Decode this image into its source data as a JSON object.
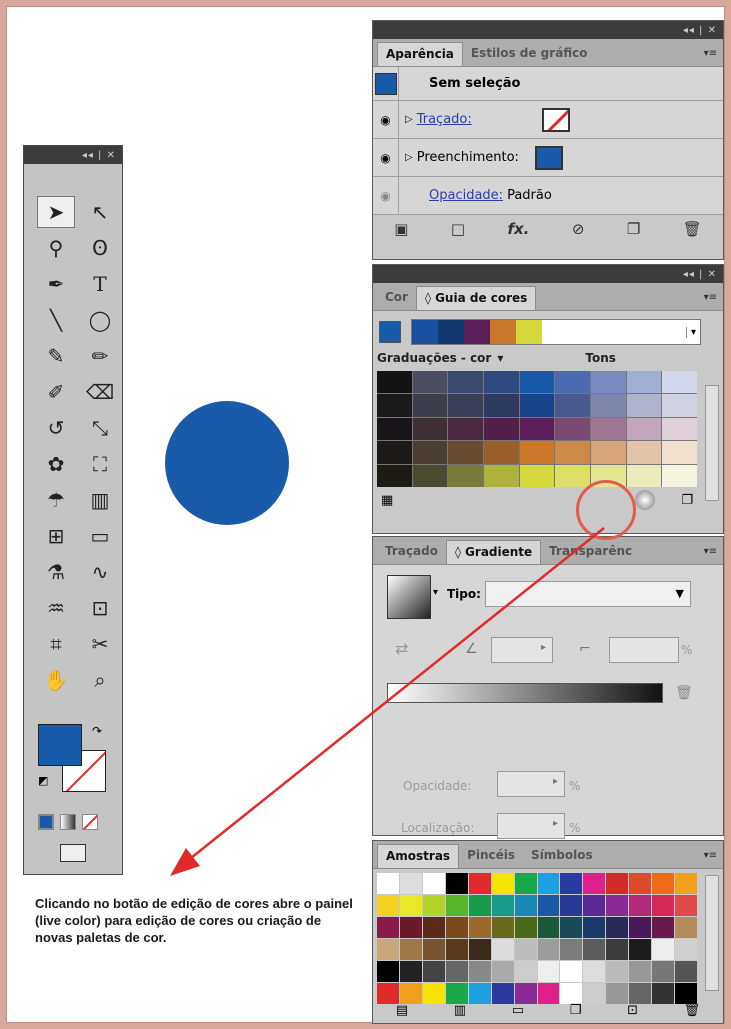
{
  "appearance_panel": {
    "tabs": [
      "Aparência",
      "Estilos de gráfico"
    ],
    "no_selection": "Sem seleção",
    "stroke_label": "Traçado:",
    "fill_label": "Preenchimento:",
    "opacity_label": "Opacidade:",
    "opacity_value": "Padrão",
    "menu_icon": "panel-menu-icon",
    "bottom_icons": [
      "new-stroke-icon",
      "new-fill-icon",
      "fx-icon",
      "clear-icon",
      "duplicate-icon",
      "delete-icon"
    ]
  },
  "color_guide_panel": {
    "tabs": [
      "Cor",
      "◊ Guia de cores"
    ],
    "variations_label": "Graduações - cor",
    "tones_label": "Tons",
    "harmony_colors": [
      "#1a4fa0",
      "#123a70",
      "#5c1f5a",
      "#c87828",
      "#d4d83c"
    ],
    "colors": {
      "blue": "#1a5aaa",
      "red": "#e12a2a"
    }
  },
  "gradient_panel": {
    "tabs": [
      "Traçado",
      "◊ Gradiente",
      "Transparênc"
    ],
    "type_label": "Tipo:",
    "opacity_label": "Opacidade:",
    "location_label": "Localização:",
    "percent": "%"
  },
  "swatches_panel": {
    "tabs": [
      "Amostras",
      "Pincéis",
      "Símbolos"
    ]
  },
  "tools_panel": {
    "title_controls": "◂◂ | ✕"
  },
  "note": {
    "text": "Clicando no botão de edição de cores abre o painel (live color) para edição de cores ou criação de novas paletas de cor."
  }
}
